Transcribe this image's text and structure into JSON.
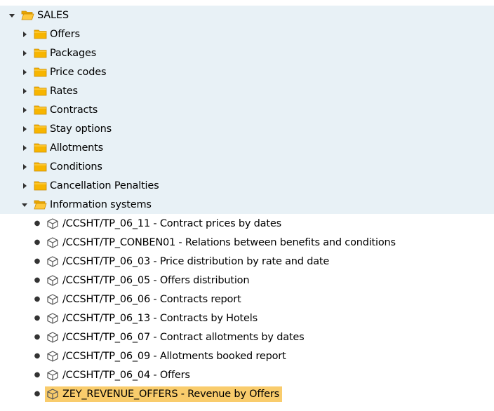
{
  "root": {
    "label": "SALES",
    "expanded": true,
    "folders": [
      {
        "label": "Offers"
      },
      {
        "label": "Packages"
      },
      {
        "label": "Price codes"
      },
      {
        "label": "Rates"
      },
      {
        "label": "Contracts"
      },
      {
        "label": "Stay options"
      },
      {
        "label": "Allotments"
      },
      {
        "label": "Conditions"
      },
      {
        "label": "Cancellation Penalties"
      },
      {
        "label": "Information systems",
        "expanded": true
      }
    ],
    "info_items": [
      {
        "label": "/CCSHT/TP_06_11 - Contract prices by dates"
      },
      {
        "label": "/CCSHT/TP_CONBEN01 - Relations between benefits and conditions"
      },
      {
        "label": "/CCSHT/TP_06_03 - Price distribution by rate and date"
      },
      {
        "label": "/CCSHT/TP_06_05 - Offers distribution"
      },
      {
        "label": "/CCSHT/TP_06_06 - Contracts report"
      },
      {
        "label": "/CCSHT/TP_06_13 - Contracts by Hotels"
      },
      {
        "label": "/CCSHT/TP_06_07 - Contract allotments by dates"
      },
      {
        "label": "/CCSHT/TP_06_09 - Allotments booked report"
      },
      {
        "label": "/CCSHT/TP_06_04 - Offers"
      },
      {
        "label": "ZEY_REVENUE_OFFERS - Revenue by Offers",
        "selected": true
      }
    ]
  },
  "colors": {
    "folder_row_bg": "#e8f1f6",
    "selection_bg": "#f9cc6c",
    "folder_fill": "#f7b500",
    "folder_stroke": "#c98a00"
  },
  "icons": {
    "collapsed": "triangle-right-icon",
    "expanded": "triangle-down-icon",
    "folder": "folder-icon",
    "open_folder": "open-folder-icon",
    "transaction": "cube-icon"
  }
}
